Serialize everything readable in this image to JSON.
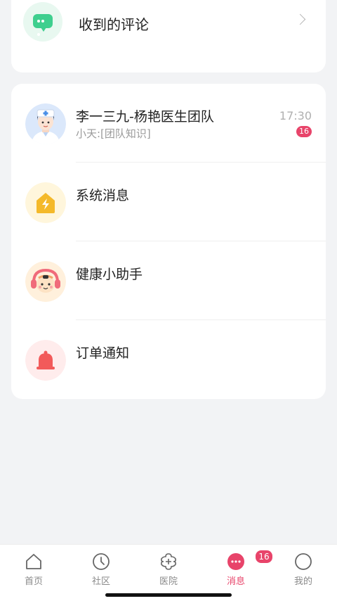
{
  "comments": {
    "label": "收到的评论"
  },
  "messages": [
    {
      "title": "李一三九-杨艳医生团队",
      "subtitle": "小天:[团队知识]",
      "time": "17:30",
      "badge": "16",
      "icon": "doctor-avatar"
    },
    {
      "title": "系统消息",
      "icon": "lightning-house-icon"
    },
    {
      "title": "健康小助手",
      "icon": "assistant-mascot-icon"
    },
    {
      "title": "订单通知",
      "icon": "bell-icon"
    }
  ],
  "tabbar": {
    "tabs": [
      {
        "label": "首页",
        "icon": "home-icon"
      },
      {
        "label": "社区",
        "icon": "community-icon"
      },
      {
        "label": "医院",
        "icon": "hospital-icon"
      },
      {
        "label": "消息",
        "icon": "message-icon",
        "active": true,
        "badge": "16"
      },
      {
        "label": "我的",
        "icon": "profile-icon"
      }
    ]
  },
  "colors": {
    "accent": "#e8446a",
    "comment_green": "#3ecf8e",
    "system_yellow": "#f4b92a",
    "bell_red": "#f25a5a",
    "background": "#f2f3f5"
  }
}
